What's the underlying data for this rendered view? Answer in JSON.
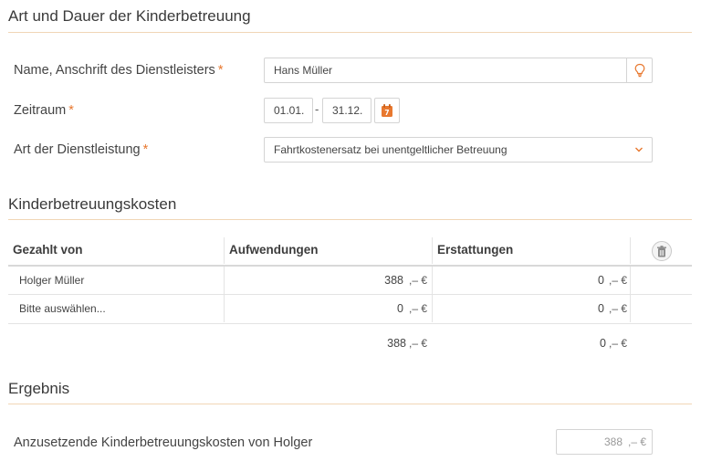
{
  "section1": {
    "title": "Art und Dauer der Kinderbetreuung",
    "name_label": "Name, Anschrift des Dienstleisters",
    "name_value": "Hans Müller",
    "zeitraum_label": "Zeitraum",
    "zeitraum_from": "01.01.",
    "zeitraum_sep": "-",
    "zeitraum_to": "31.12.",
    "art_label": "Art der Dienstleistung",
    "art_value": "Fahrtkostenersatz bei unentgeltlicher Betreuung",
    "required_mark": "*"
  },
  "section2": {
    "title": "Kinderbetreuungskosten",
    "columns": [
      "Gezahlt von",
      "Aufwendungen",
      "Erstattungen"
    ],
    "rows": [
      {
        "payer": "Holger Müller",
        "aufwendungen": "388",
        "erstattungen": "0"
      },
      {
        "payer": "Bitte auswählen...",
        "aufwendungen": "0",
        "erstattungen": "0"
      }
    ],
    "totals": {
      "aufwendungen": "388",
      "erstattungen": "0"
    },
    "currency_suffix": ",– €"
  },
  "section3": {
    "title": "Ergebnis",
    "label": "Anzusetzende Kinderbetreuungskosten von Holger",
    "value": "388",
    "currency_suffix": ",– €"
  },
  "icons": {
    "name_field_icon": "lightbulb-icon",
    "calendar_icon": "calendar-icon",
    "dropdown_icon": "chevron-down-icon",
    "delete_icon": "trash-icon"
  },
  "colors": {
    "accent": "#e8782f",
    "rule": "#f1d6b6"
  }
}
